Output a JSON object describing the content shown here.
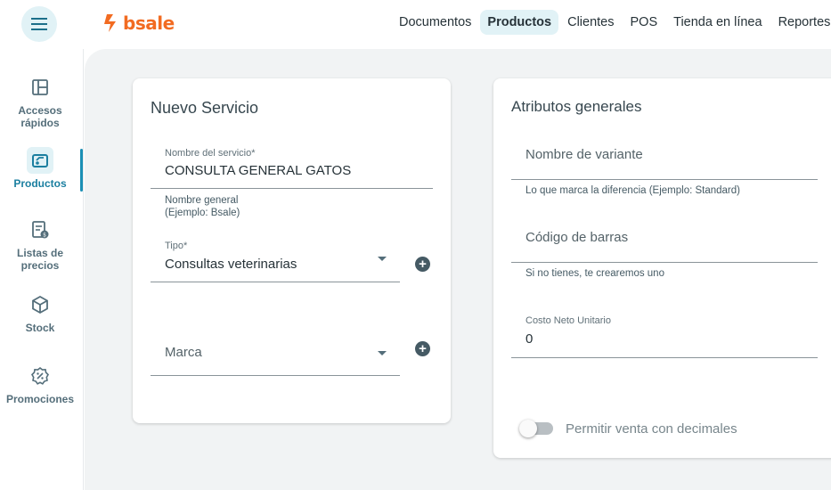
{
  "brand": {
    "name": "bsale",
    "color": "#f26b21"
  },
  "header": {
    "nav": [
      {
        "label": "Documentos",
        "active": false
      },
      {
        "label": "Productos",
        "active": true
      },
      {
        "label": "Clientes",
        "active": false
      },
      {
        "label": "POS",
        "active": false
      },
      {
        "label": "Tienda en línea",
        "active": false
      },
      {
        "label": "Reportes",
        "active": false
      }
    ]
  },
  "sidebar": {
    "items": [
      {
        "label_line1": "Accesos",
        "label_line2": "rápidos",
        "icon": "grid-icon"
      },
      {
        "label_line1": "Productos",
        "label_line2": "",
        "icon": "product-tag-icon",
        "active": true
      },
      {
        "label_line1": "Listas de",
        "label_line2": "precios",
        "icon": "price-list-icon"
      },
      {
        "label_line1": "Stock",
        "label_line2": "",
        "icon": "box-icon"
      },
      {
        "label_line1": "Promociones",
        "label_line2": "",
        "icon": "percent-badge-icon"
      }
    ]
  },
  "service_card": {
    "title": "Nuevo Servicio",
    "name_field": {
      "label": "Nombre del servicio*",
      "value": "CONSULTA GENERAL GATOS"
    },
    "general_name_help": {
      "line1": "Nombre general",
      "line2": "(Ejemplo: Bsale)"
    },
    "type_field": {
      "label": "Tipo*",
      "value": "Consultas veterinarias"
    },
    "brand_field": {
      "placeholder": "Marca"
    }
  },
  "attributes_card": {
    "title": "Atributos generales",
    "variant_field": {
      "placeholder": "Nombre de variante",
      "helper": "Lo que marca la diferencia (Ejemplo: Standard)"
    },
    "barcode_field": {
      "placeholder": "Código de barras",
      "helper": "Si no tienes, te crearemos uno"
    },
    "cost_field": {
      "label": "Costo Neto Unitario",
      "value": "0"
    },
    "decimals_toggle": {
      "label": "Permitir venta con decimales",
      "enabled": false
    }
  },
  "colors": {
    "accent": "#1b8fb5",
    "accent_bg": "#e1f2f6",
    "content_bg": "#f1f3f4"
  }
}
